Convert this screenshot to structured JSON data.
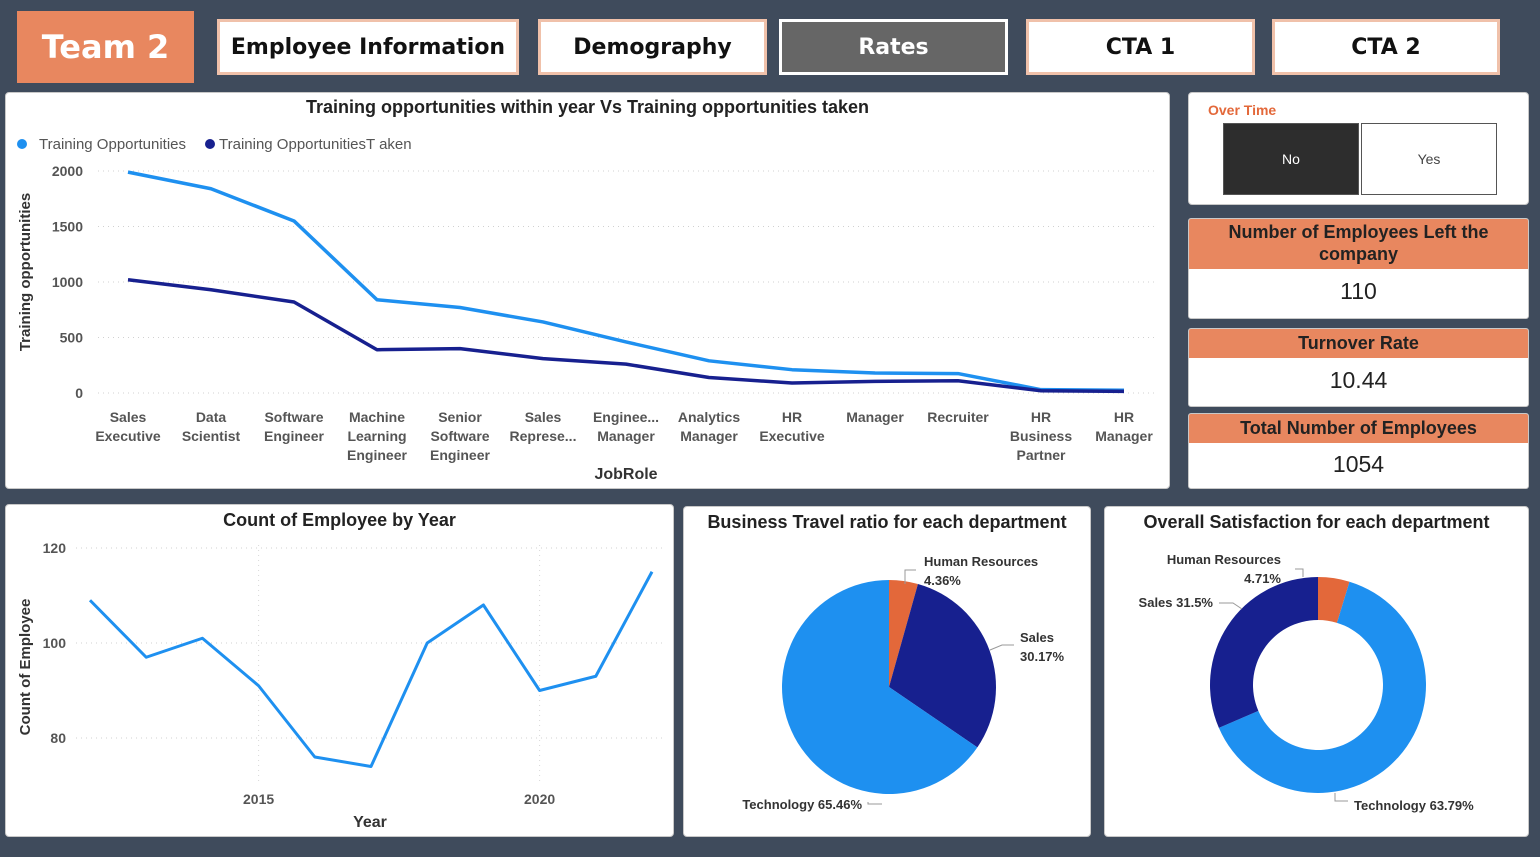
{
  "header": {
    "team": "Team 2",
    "tabs": [
      {
        "label": "Employee Information"
      },
      {
        "label": "Demography"
      },
      {
        "label": "Rates"
      },
      {
        "label": "CTA 1"
      },
      {
        "label": "CTA 2"
      }
    ],
    "active_tab": "Rates"
  },
  "slicer": {
    "title": "Over Time",
    "options": [
      "No",
      "Yes"
    ],
    "selected": "No"
  },
  "kpis": [
    {
      "label": "Number of Employees Left the company",
      "value": "110"
    },
    {
      "label": "Turnover Rate",
      "value": "10.44"
    },
    {
      "label": "Total Number of Employees",
      "value": "1054"
    }
  ],
  "colors": {
    "accent": "#e8875f",
    "series_light": "#1e90f0",
    "series_dark": "#17208f",
    "pie_orange": "#e3683a",
    "background": "#3f4b5c"
  },
  "chart_data": [
    {
      "type": "line",
      "title": "Training opportunities within year Vs Training opportunities taken",
      "xlabel": "JobRole",
      "ylabel": "Training opportunities",
      "categories": [
        [
          "Sales",
          "Executive"
        ],
        [
          "Data",
          "Scientist"
        ],
        [
          "Software",
          "Engineer"
        ],
        [
          "Machine",
          "Learning",
          "Engineer"
        ],
        [
          "Senior",
          "Software",
          "Engineer"
        ],
        [
          "Sales",
          "Represe..."
        ],
        [
          "Enginee...",
          "Manager"
        ],
        [
          "Analytics",
          "Manager"
        ],
        [
          "HR",
          "Executive"
        ],
        [
          "Manager"
        ],
        [
          "Recruiter"
        ],
        [
          "HR",
          "Business",
          "Partner"
        ],
        [
          "HR",
          "Manager"
        ]
      ],
      "series": [
        {
          "name": "Training Opportunities",
          "values": [
            1990,
            1840,
            1550,
            840,
            770,
            640,
            460,
            290,
            210,
            180,
            175,
            30,
            25
          ]
        },
        {
          "name": "Training OpportunitiesT aken",
          "values": [
            1020,
            930,
            820,
            390,
            400,
            310,
            260,
            140,
            90,
            105,
            110,
            20,
            15
          ]
        }
      ],
      "yticks": [
        "2000",
        "1500",
        "1000",
        "500",
        "0"
      ],
      "ylim": [
        0,
        2000
      ],
      "grid": true,
      "legend": "top-left"
    },
    {
      "type": "line",
      "title": "Count of Employee by Year",
      "xlabel": "Year",
      "ylabel": "Count of Employee",
      "x": [
        2012,
        2013,
        2014,
        2015,
        2016,
        2017,
        2018,
        2019,
        2020,
        2021,
        2022
      ],
      "values": [
        109,
        97,
        101,
        91,
        76,
        74,
        100,
        108,
        90,
        93,
        115
      ],
      "yticks": [
        "120",
        "100",
        "80"
      ],
      "xticks": [
        "2015",
        "2020"
      ],
      "ylim": [
        80,
        120
      ],
      "grid": true
    },
    {
      "type": "pie",
      "title": "Business Travel ratio for each department",
      "slices": [
        {
          "name": "Human Resources",
          "value": 4.36,
          "label_name": "Human Resources",
          "label_pct": "4.36%",
          "color": "#e3683a"
        },
        {
          "name": "Sales",
          "value": 30.17,
          "label_name": "Sales",
          "label_pct": "30.17%",
          "color": "#17208f"
        },
        {
          "name": "Technology",
          "value": 65.46,
          "label_name": "Technology 65.46%",
          "label_pct": "",
          "color": "#1e90f0"
        }
      ]
    },
    {
      "type": "pie",
      "donut": true,
      "title": "Overall Satisfaction for each department",
      "slices": [
        {
          "name": "Human Resources",
          "value": 4.71,
          "label_name": "Human Resources",
          "label_pct": "4.71%",
          "color": "#e3683a"
        },
        {
          "name": "Technology",
          "value": 63.79,
          "label_name": "Technology 63.79%",
          "label_pct": "",
          "color": "#1e90f0"
        },
        {
          "name": "Sales",
          "value": 31.5,
          "label_name": "Sales 31.5%",
          "label_pct": "",
          "color": "#17208f"
        }
      ]
    }
  ]
}
